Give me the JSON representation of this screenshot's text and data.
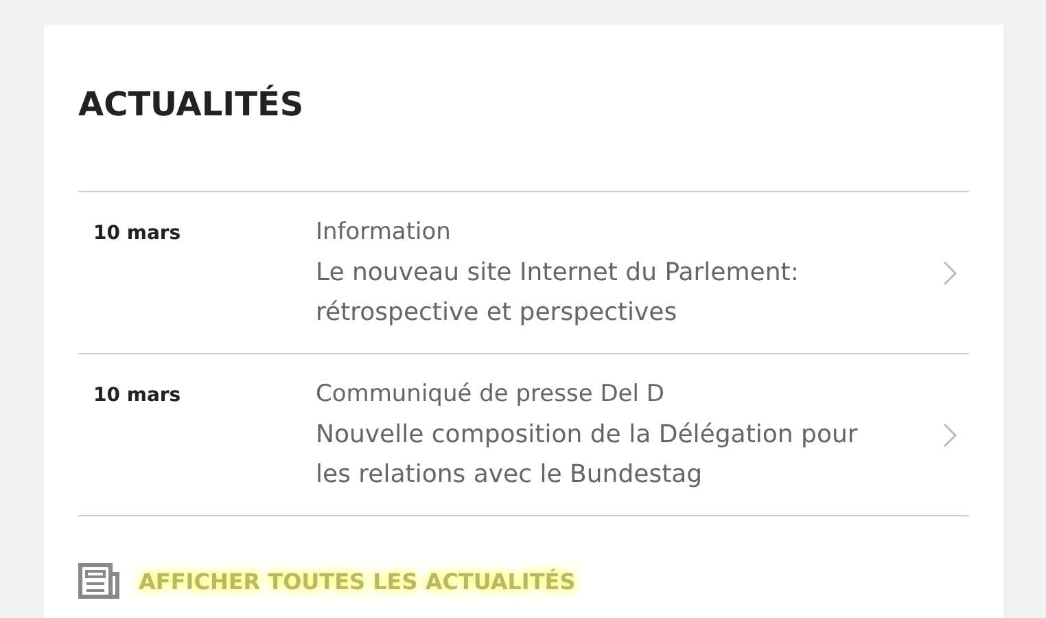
{
  "title": "ACTUALITÉS",
  "news": [
    {
      "date": "10 mars",
      "category": "Information",
      "headline": "Le nouveau site Internet du Parlement: rétrospective et perspectives"
    },
    {
      "date": "10 mars",
      "category": "Communiqué de presse Del D",
      "headline": "Nouvelle composition de la Délégation pour les relations avec le Bundestag"
    }
  ],
  "more_link": "AFFICHER TOUTES LES ACTUALITÉS"
}
